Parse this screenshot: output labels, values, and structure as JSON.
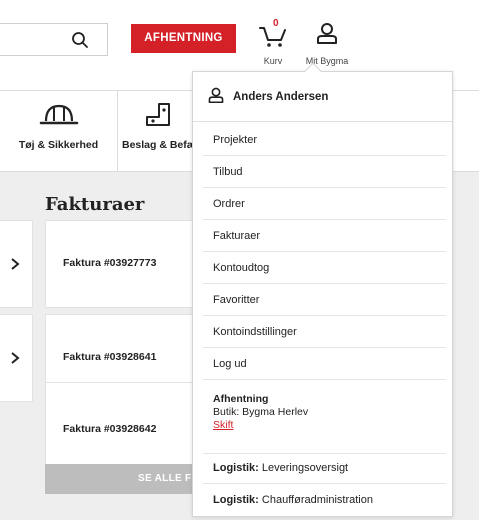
{
  "header": {
    "pickup_button": "AFHENTNING",
    "cart_count": "0",
    "cart_label": "Kurv",
    "account_label": "Mit Bygma"
  },
  "categories": [
    {
      "label": "Tøj & Sikkerhed",
      "icon": "hard-hat-icon"
    },
    {
      "label": "Beslag & Befæ",
      "icon": "bracket-icon"
    }
  ],
  "main": {
    "title": "Fakturaer",
    "invoices": [
      {
        "label": "Faktura #03927773"
      },
      {
        "label": "Faktura #03928641"
      },
      {
        "label": "Faktura #03928642"
      }
    ],
    "see_all": "SE ALLE F"
  },
  "dropdown": {
    "user_name": "Anders Andersen",
    "items": [
      {
        "label": "Projekter"
      },
      {
        "label": "Tilbud"
      },
      {
        "label": "Ordrer"
      },
      {
        "label": "Fakturaer"
      },
      {
        "label": "Kontoudtog"
      },
      {
        "label": "Favoritter"
      },
      {
        "label": "Kontoindstillinger"
      },
      {
        "label": "Log ud"
      }
    ],
    "pickup": {
      "title": "Afhentning",
      "store": "Butik: Bygma Herlev",
      "change": "Skift"
    },
    "logistics": [
      {
        "prefix": "Logistik:",
        "label": "Leveringsoversigt"
      },
      {
        "prefix": "Logistik:",
        "label": "Chaufføradministration"
      }
    ]
  },
  "colors": {
    "brand_red": "#d42027",
    "page_bg": "#eeeeee",
    "button_grey": "#bdbdbd"
  }
}
